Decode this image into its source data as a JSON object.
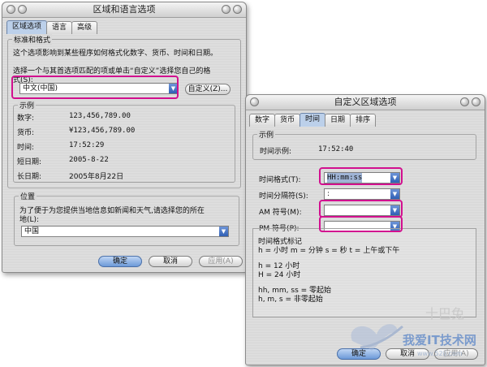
{
  "left": {
    "title": "区域和语言选项",
    "tabs": [
      "区域选项",
      "语言",
      "高级"
    ],
    "std_group": "标准和格式",
    "std_desc": "这个选项影响到某些程序如何格式化数字、货币、时间和日期。",
    "choose_line1": "选择一个与其首选项匹配的项或单击“自定义”选择您自己的格",
    "choose_line2": "式(S):",
    "locale_value": "中文(中国)",
    "customize_button": "自定义(Z)...",
    "sample_group": "示例",
    "samples": [
      {
        "label": "数字:",
        "value": "123,456,789.00"
      },
      {
        "label": "货币:",
        "value": "¥123,456,789.00"
      },
      {
        "label": "时间:",
        "value": "17:52:29"
      },
      {
        "label": "短日期:",
        "value": "2005-8-22"
      },
      {
        "label": "长日期:",
        "value": "2005年8月22日"
      }
    ],
    "location_group": "位置",
    "location_line1": "为了便于为您提供当地信息如新闻和天气,请选择您的所在",
    "location_line2": "地(L):",
    "location_value": "中国",
    "ok": "确定",
    "cancel": "取消",
    "apply": "应用(A)"
  },
  "right": {
    "title": "自定义区域选项",
    "tabs": [
      "数字",
      "货币",
      "时间",
      "日期",
      "排序"
    ],
    "sample_group": "示例",
    "time_sample_label": "时间示例:",
    "time_sample_value": "17:52:40",
    "time_format_label": "时间格式(T):",
    "time_format_value": "HH:mm:ss",
    "time_sep_label": "时间分隔符(S):",
    "time_sep_value": ":",
    "am_label": "AM 符号(M):",
    "am_value": "",
    "pm_label": "PM 符号(P):",
    "pm_value": "",
    "notation_title": "时间格式标记",
    "notation_line1": "h = 小时    m = 分钟    s = 秒    t = 上午或下午",
    "notation_line2": "h = 12 小时",
    "notation_line3": "H = 24 小时",
    "notation_line4": "hh, mm, ss = 零起始",
    "notation_line5": "h, m, s = 非零起始",
    "ok": "确定",
    "cancel": "取消",
    "apply": "应用(A)"
  },
  "watermark": {
    "line1": "十巴兔",
    "line2": "我爱IT技术网",
    "line3": "www.52ij.com"
  },
  "colors": {
    "highlight": "#d2108f",
    "tab_active": "#bcd0ea",
    "button_default": "#6c9ad8"
  }
}
